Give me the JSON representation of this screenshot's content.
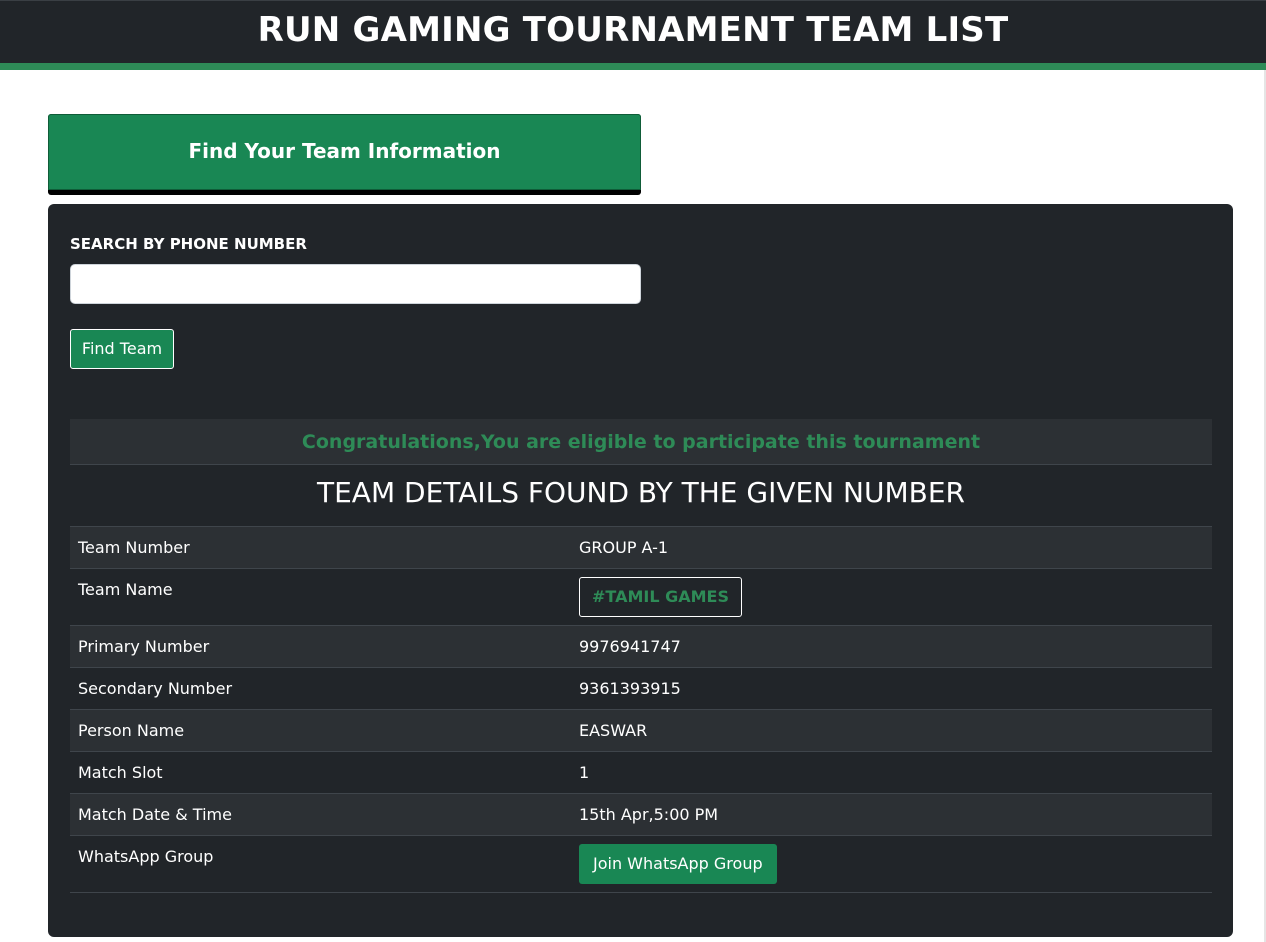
{
  "header": {
    "title": "RUN GAMING TOURNAMENT TEAM LIST"
  },
  "banner": {
    "title": "Find Your Team Information"
  },
  "search": {
    "label": "SEARCH BY PHONE NUMBER",
    "value": "",
    "button_label": "Find Team"
  },
  "result": {
    "message": "Congratulations,You are eligible to participate this tournament",
    "heading": "TEAM DETAILS FOUND BY THE GIVEN NUMBER",
    "rows": [
      {
        "key": "Team Number",
        "value": "GROUP A-1"
      },
      {
        "key": "Team Name",
        "value": "#TAMIL GAMES"
      },
      {
        "key": "Primary Number",
        "value": "9976941747"
      },
      {
        "key": "Secondary Number",
        "value": "9361393915"
      },
      {
        "key": "Person Name",
        "value": "EASWAR"
      },
      {
        "key": "Match Slot",
        "value": "1"
      },
      {
        "key": "Match Date & Time",
        "value": "15th Apr,5:00 PM"
      },
      {
        "key": "WhatsApp Group",
        "value": "Join WhatsApp Group"
      }
    ]
  },
  "colors": {
    "dark": "#212529",
    "green": "#198754",
    "message_green": "#2e8b57"
  }
}
